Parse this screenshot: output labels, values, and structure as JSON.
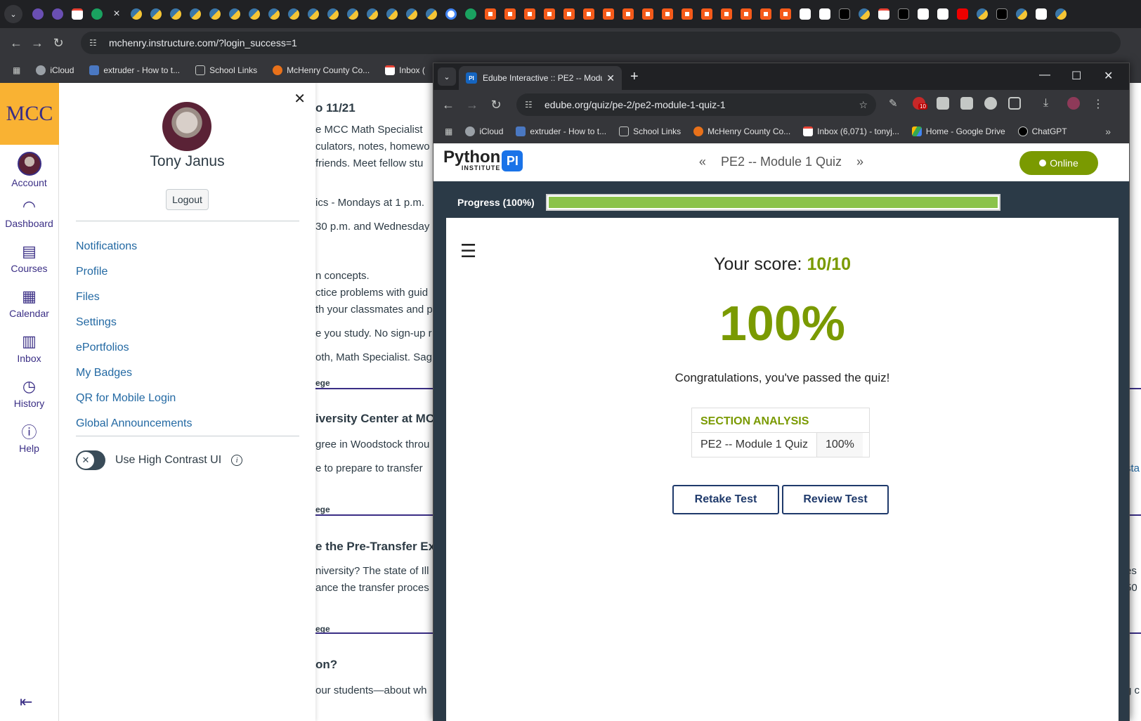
{
  "browser_back": {
    "tabs_closed_label": "×",
    "url": "mchenry.instructure.com/?login_success=1",
    "bookmarks": [
      {
        "label": "iCloud"
      },
      {
        "label": "extruder - How to t..."
      },
      {
        "label": "School Links"
      },
      {
        "label": "McHenry County Co..."
      },
      {
        "label": "Inbox ("
      }
    ]
  },
  "canvas": {
    "logo": "MCC",
    "nav": [
      {
        "label": "Account",
        "icon": "account-avatar"
      },
      {
        "label": "Dashboard",
        "icon": "dashboard-icon"
      },
      {
        "label": "Courses",
        "icon": "courses-icon"
      },
      {
        "label": "Calendar",
        "icon": "calendar-icon"
      },
      {
        "label": "Inbox",
        "icon": "inbox-icon"
      },
      {
        "label": "History",
        "icon": "history-icon"
      },
      {
        "label": "Help",
        "icon": "help-icon"
      }
    ],
    "tray": {
      "username": "Tony Janus",
      "logout": "Logout",
      "links": [
        "Notifications",
        "Profile",
        "Files",
        "Settings",
        "ePortfolios",
        "My Badges",
        "QR for Mobile Login",
        "Global Announcements"
      ],
      "high_contrast_label": "Use High Contrast UI"
    },
    "announcements": [
      {
        "text": "o 11/21",
        "kind": "head"
      },
      {
        "text": "e MCC Math Specialist",
        "kind": "body"
      },
      {
        "text": "culators, notes, homewo",
        "kind": "body"
      },
      {
        "text": "friends. Meet fellow stu",
        "kind": "body"
      },
      {
        "text": "ics - Mondays at 1 p.m.",
        "kind": "body"
      },
      {
        "text": "30 p.m. and Wednesday",
        "kind": "body"
      },
      {
        "text": "n concepts.",
        "kind": "body"
      },
      {
        "text": "ctice problems with guid",
        "kind": "body"
      },
      {
        "text": "th your classmates and p",
        "kind": "body"
      },
      {
        "text": "e you study. No sign-up r",
        "kind": "body"
      },
      {
        "text": "oth, Math Specialist. Sag",
        "kind": "body"
      },
      {
        "text": "ege",
        "kind": "small"
      },
      {
        "text": "iversity Center at MC",
        "kind": "head"
      },
      {
        "text": "gree in Woodstock throu",
        "kind": "body"
      },
      {
        "text": "e to prepare to transfer",
        "kind": "body"
      },
      {
        "text": "ege",
        "kind": "small"
      },
      {
        "text": "e the Pre-Transfer Exp",
        "kind": "head"
      },
      {
        "text": "niversity? The state of Ill",
        "kind": "body"
      },
      {
        "text": "ance the transfer proces",
        "kind": "body"
      },
      {
        "text": "ege",
        "kind": "small"
      },
      {
        "text": "on?",
        "kind": "head"
      },
      {
        "text": "our students—about wh",
        "kind": "body"
      }
    ],
    "edge_texts": [
      "sta",
      "es",
      "50",
      "g c"
    ]
  },
  "browser_front": {
    "tab_title": "Edube Interactive :: PE2 -- Modu",
    "url": "edube.org/quiz/pe-2/pe2-module-1-quiz-1",
    "ext_badge": "10",
    "bookmarks": [
      {
        "label": "iCloud"
      },
      {
        "label": "extruder - How to t..."
      },
      {
        "label": "School Links"
      },
      {
        "label": "McHenry County Co..."
      },
      {
        "label": "Inbox (6,071) - tonyj..."
      },
      {
        "label": "Home - Google Drive"
      },
      {
        "label": "ChatGPT"
      }
    ]
  },
  "quiz": {
    "logo_word": "Python",
    "logo_sub": "INSTITUTE",
    "logo_badge": "PI",
    "title": "PE2 -- Module 1 Quiz",
    "status": "Online",
    "progress_label": "Progress (100%)",
    "progress_value": 1.0,
    "score_label": "Your score:",
    "score_value": "10/10",
    "percent": "100%",
    "message": "Congratulations, you've passed the quiz!",
    "section_title": "SECTION ANALYSIS",
    "section_rows": [
      {
        "name": "PE2 -- Module 1 Quiz",
        "value": "100%"
      }
    ],
    "retake": "Retake Test",
    "review": "Review Test"
  },
  "colors": {
    "accent_green": "#7a9a01",
    "canvas_purple": "#3a2e85",
    "mcc_gold": "#f9b233"
  }
}
